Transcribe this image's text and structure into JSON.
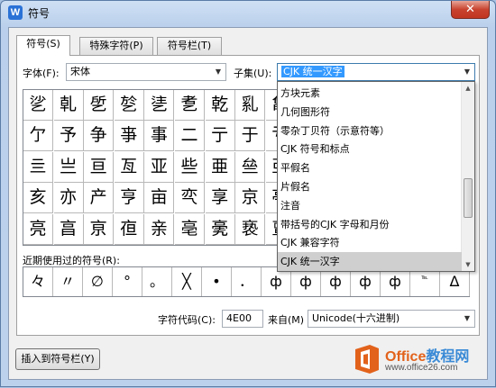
{
  "window": {
    "title": "符号",
    "app_icon_letter": "W",
    "close_glyph": "✕"
  },
  "tabs": [
    {
      "label": "符号(S)"
    },
    {
      "label": "特殊字符(P)"
    },
    {
      "label": "符号栏(T)"
    }
  ],
  "font": {
    "label": "字体(F):",
    "value": "宋体"
  },
  "subset": {
    "label": "子集(U):",
    "value": "CJK 统一汉字"
  },
  "grid_rows": [
    [
      "乷",
      "乹",
      "乺",
      "乻",
      "乼",
      "乽",
      "乾",
      "乿",
      "亀"
    ],
    [
      "亇",
      "予",
      "争",
      "亊",
      "事",
      "二",
      "亍",
      "于",
      "亐"
    ],
    [
      "亖",
      "亗",
      "亘",
      "亙",
      "亚",
      "些",
      "亜",
      "亝",
      "亞"
    ],
    [
      "亥",
      "亦",
      "产",
      "亨",
      "亩",
      "亪",
      "享",
      "京",
      "亭"
    ],
    [
      "亮",
      "亯",
      "亰",
      "亱",
      "亲",
      "亳",
      "亴",
      "亵",
      "亶"
    ]
  ],
  "subset_dropdown": {
    "items": [
      "方块元素",
      "几何图形符",
      "零杂丁贝符（示意符等）",
      "CJK 符号和标点",
      "平假名",
      "片假名",
      "注音",
      "带括号的CJK 字母和月份",
      "CJK 兼容字符",
      "CJK 统一汉字"
    ],
    "selected_index": 9
  },
  "recent": {
    "label": "近期使用过的符号(R):",
    "symbols": [
      "々",
      "〃",
      "∅",
      "°",
      "。",
      "╳",
      "•",
      "．",
      "ф",
      "ф",
      "ф",
      "ф",
      "ф",
      "℡",
      "Δ"
    ]
  },
  "char_code": {
    "label": "字符代码(C):",
    "value": "4E00"
  },
  "from": {
    "label": "来自(M)",
    "value": "Unicode(十六进制)"
  },
  "buttons": {
    "insert_to_bar": "插入到符号栏(Y)"
  },
  "watermark": {
    "brand_a": "Office",
    "brand_b": "教程网",
    "url": "www.office26.com"
  }
}
